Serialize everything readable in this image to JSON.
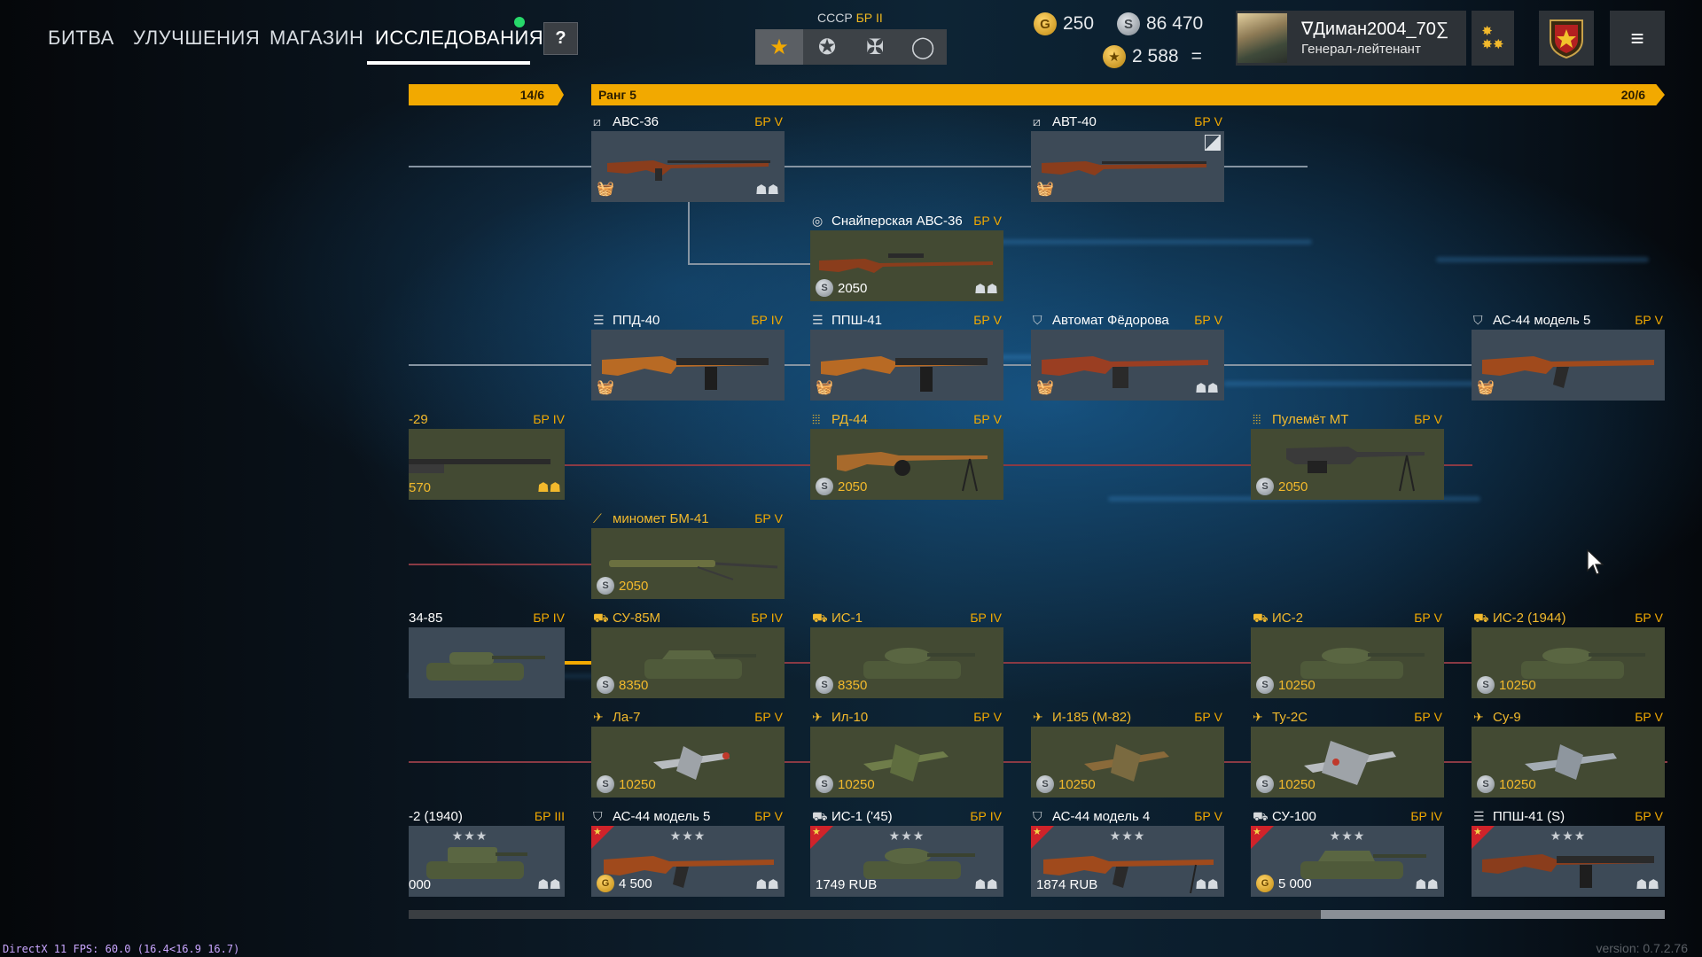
{
  "nav": {
    "battle": "БИТВА",
    "upgrades": "УЛУЧШЕНИЯ",
    "shop": "МАГАЗИН",
    "research": "ИССЛЕДОВАНИЯ",
    "help": "?"
  },
  "nation": {
    "country": "СССР",
    "br": "БР II"
  },
  "filters": [
    "star-icon",
    "circle-star-icon",
    "cross-icon",
    "ring-icon"
  ],
  "currency": {
    "gold": "250",
    "silver": "86 470",
    "rank_points": "2 588",
    "equals": "="
  },
  "profile": {
    "name": "∇Диман2004_70∑",
    "rank": "Генерал-лейтенант"
  },
  "rank_bar": {
    "left_count": "14/6",
    "title": "Ранг 5",
    "count": "20/6"
  },
  "cards": {
    "avs36": {
      "name": "АВС-36",
      "br": "БР V"
    },
    "avt40": {
      "name": "АВТ-40",
      "br": "БР V"
    },
    "sniper_avs36": {
      "name": "Снайперская АВС-36",
      "br": "БР V",
      "price": "2050"
    },
    "ppd40": {
      "name": "ППД-40",
      "br": "БР IV"
    },
    "ppsh41": {
      "name": "ППШ-41",
      "br": "БР V"
    },
    "fedorov": {
      "name": "Автомат Фёдорова",
      "br": "БР V"
    },
    "as44_5": {
      "name": "АС-44 модель 5",
      "br": "БР V"
    },
    "dt29": {
      "name": "-29",
      "br": "БР IV",
      "price": "570"
    },
    "rd44": {
      "name": "РД-44",
      "br": "БР V",
      "price": "2050"
    },
    "mt": {
      "name": "Пулемёт МТ",
      "br": "БР V",
      "price": "2050"
    },
    "bm41": {
      "name": "миномет БМ-41",
      "br": "БР V",
      "price": "2050"
    },
    "t3485": {
      "name": "34-85",
      "br": "БР IV"
    },
    "su85m": {
      "name": "СУ-85М",
      "br": "БР IV",
      "price": "8350"
    },
    "is1": {
      "name": "ИС-1",
      "br": "БР IV",
      "price": "8350"
    },
    "is2": {
      "name": "ИС-2",
      "br": "БР V",
      "price": "10250"
    },
    "is2_44": {
      "name": "ИС-2 (1944)",
      "br": "БР V",
      "price": "10250"
    },
    "la7": {
      "name": "Ла-7",
      "br": "БР V",
      "price": "10250"
    },
    "il10": {
      "name": "Ил-10",
      "br": "БР V",
      "price": "10250"
    },
    "i185": {
      "name": "И-185 (М-82)",
      "br": "БР V",
      "price": "10250"
    },
    "tu2s": {
      "name": "Ту-2С",
      "br": "БР V",
      "price": "10250"
    },
    "su9": {
      "name": "Су-9",
      "br": "БР V",
      "price": "10250"
    },
    "kv2": {
      "name": "-2 (1940)",
      "br": "БР III",
      "price": "000"
    },
    "p_as44_5": {
      "name": "АС-44 модель 5",
      "br": "БР V",
      "price": "4 500"
    },
    "p_is1": {
      "name": "ИС-1 ('45)",
      "br": "БР IV",
      "price": "1749 RUB"
    },
    "p_as44_4": {
      "name": "АС-44 модель 4",
      "br": "БР V",
      "price": "1874 RUB"
    },
    "p_su100": {
      "name": "СУ-100",
      "br": "БР IV",
      "price": "5 000"
    },
    "p_ppsh41s": {
      "name": "ППШ-41 (S)",
      "br": "БР V"
    }
  },
  "footer": {
    "fps": "DirectX 11 FPS: 60.0 (16.4<16.9 16.7)",
    "version": "version: 0.7.2.76"
  }
}
